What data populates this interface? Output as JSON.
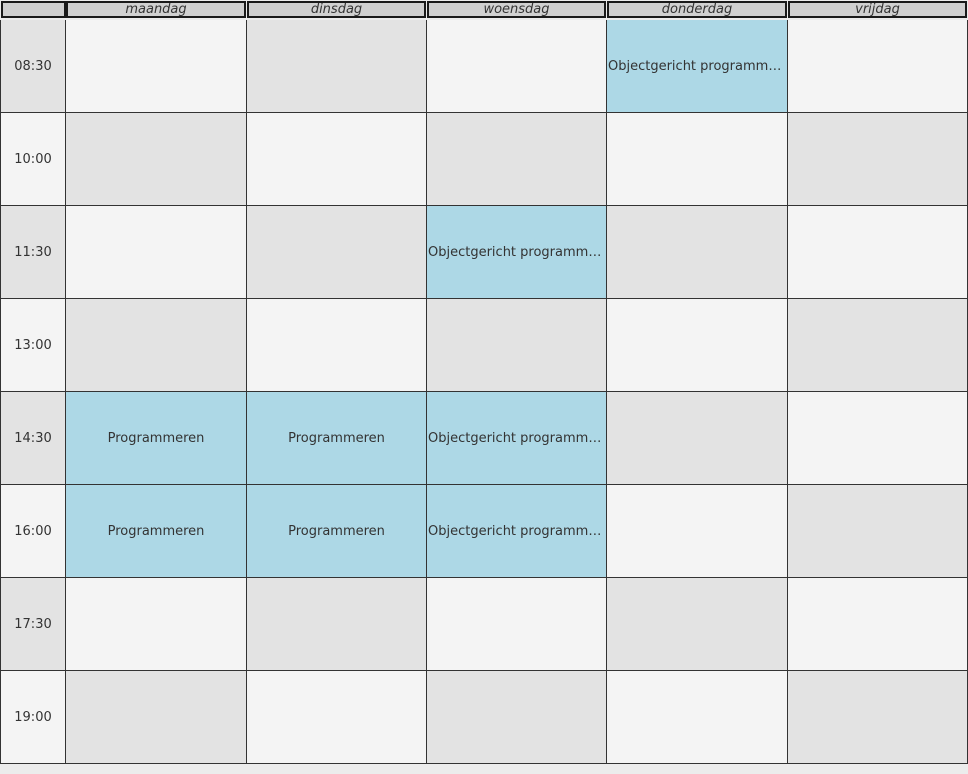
{
  "corner": "",
  "days": [
    "maandag",
    "dinsdag",
    "woensdag",
    "donderdag",
    "vrijdag"
  ],
  "times": [
    "08:30",
    "10:00",
    "11:30",
    "13:00",
    "14:30",
    "16:00",
    "17:30",
    "19:00"
  ],
  "schedule": [
    [
      "",
      "",
      "",
      "Objectgericht programmeren",
      ""
    ],
    [
      "",
      "",
      "",
      "",
      ""
    ],
    [
      "",
      "",
      "Objectgericht programmeren",
      "",
      ""
    ],
    [
      "",
      "",
      "",
      "",
      ""
    ],
    [
      "Programmeren",
      "Programmeren",
      "Objectgericht programmeren",
      "",
      ""
    ],
    [
      "Programmeren",
      "Programmeren",
      "Objectgericht programmeren",
      "",
      ""
    ],
    [
      "",
      "",
      "",
      "",
      ""
    ],
    [
      "",
      "",
      "",
      "",
      ""
    ]
  ],
  "colors": {
    "course": "#add8e6",
    "cell_light": "#f4f4f4",
    "cell_dark": "#e3e3e3",
    "header": "#d0d0d0"
  }
}
